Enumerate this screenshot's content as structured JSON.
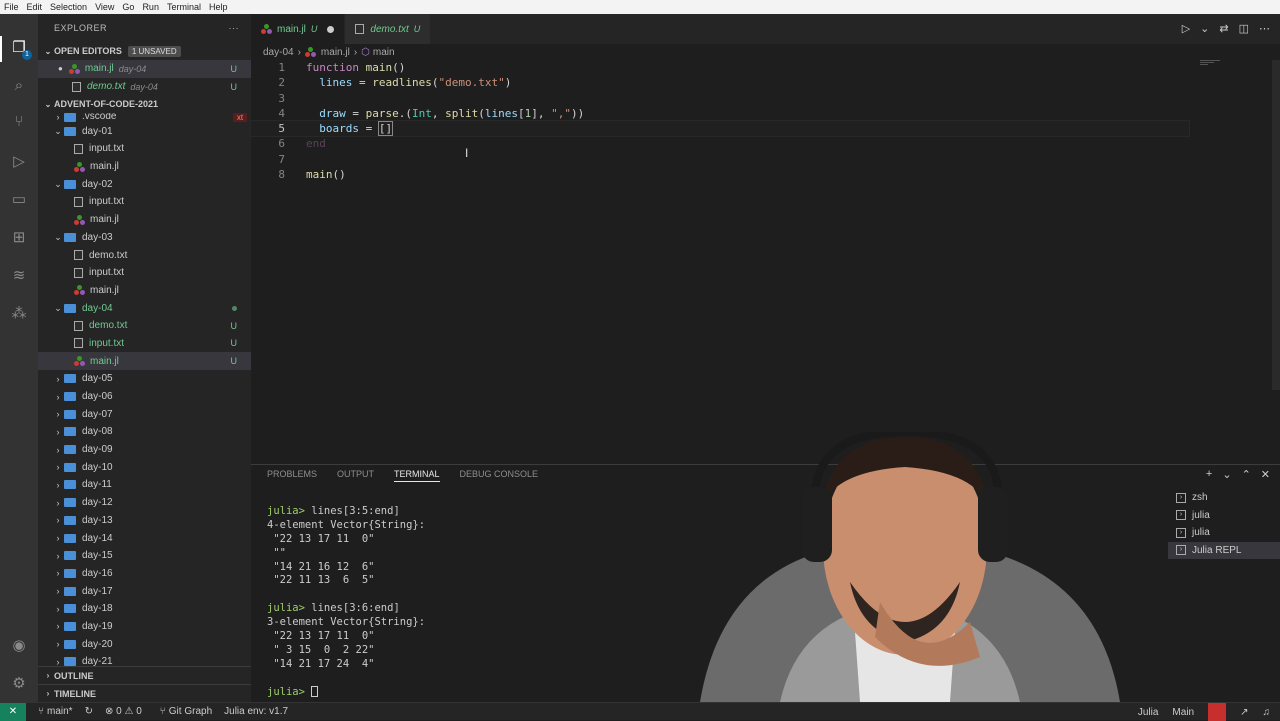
{
  "menu": [
    "File",
    "Edit",
    "Selection",
    "View",
    "Go",
    "Run",
    "Terminal",
    "Help"
  ],
  "explorer": {
    "title": "EXPLORER",
    "more": "···",
    "open_editors": {
      "label": "OPEN EDITORS",
      "badge": "1 UNSAVED"
    },
    "open_files": [
      {
        "name": "main.jl",
        "desc": "day-04",
        "status": "U"
      },
      {
        "name": "demo.txt",
        "desc": "day-04",
        "status": "U"
      }
    ],
    "workspace": "ADVENT-OF-CODE-2021",
    "vscode": ".vscode",
    "badge_x": "xt",
    "day01": {
      "name": "day-01",
      "files": [
        "input.txt",
        "main.jl"
      ]
    },
    "day02": {
      "name": "day-02",
      "files": [
        "input.txt",
        "main.jl"
      ]
    },
    "day03": {
      "name": "day-03",
      "files": [
        "demo.txt",
        "input.txt",
        "main.jl"
      ]
    },
    "day04": {
      "name": "day-04",
      "files": [
        {
          "name": "demo.txt",
          "status": "U"
        },
        {
          "name": "input.txt",
          "status": "U"
        },
        {
          "name": "main.jl",
          "status": "U"
        }
      ]
    },
    "collapsed": [
      "day-05",
      "day-06",
      "day-07",
      "day-08",
      "day-09",
      "day-10",
      "day-11",
      "day-12",
      "day-13",
      "day-14",
      "day-15",
      "day-16",
      "day-17",
      "day-18",
      "day-19",
      "day-20",
      "day-21"
    ],
    "outline": "OUTLINE",
    "timeline": "TIMELINE"
  },
  "tabs": [
    {
      "name": "main.jl",
      "tag": "U"
    },
    {
      "name": "demo.txt",
      "tag": "U"
    }
  ],
  "breadcrumb": {
    "folder": "day-04",
    "file": "main.jl",
    "symbol": "main"
  },
  "code": {
    "l1": [
      "function",
      " ",
      "main",
      "()"
    ],
    "l2": [
      "  lines",
      " = ",
      "readlines",
      "(",
      "\"demo.txt\"",
      ")"
    ],
    "l4": [
      "  draw",
      " = ",
      "parse",
      ".(",
      "Int",
      ", ",
      "split",
      "(",
      "lines",
      "[",
      "1",
      "], ",
      "\",\"",
      "))"
    ],
    "l5": [
      "  boards",
      " = ",
      "[]"
    ],
    "l6": "end",
    "l8": [
      "main",
      "()"
    ]
  },
  "panel": {
    "tabs": [
      "PROBLEMS",
      "OUTPUT",
      "TERMINAL",
      "DEBUG CONSOLE"
    ],
    "terminal_lines": [
      "julia> lines[3:5:end]",
      "4-element Vector{String}:",
      " \"22 13 17 11  0\"",
      " \"\"",
      " \"14 21 16 12  6\"",
      " \"22 11 13  6  5\"",
      "",
      "julia> lines[3:6:end]",
      "3-element Vector{String}:",
      " \"22 13 17 11  0\"",
      " \" 3 15  0  2 22\"",
      " \"14 21 17 24  4\"",
      ""
    ],
    "prompt": "julia> ",
    "terminals": [
      "zsh",
      "julia",
      "julia",
      "Julia REPL"
    ]
  },
  "status": {
    "remote": "✕",
    "branch": "main*",
    "problems": "⊗ 0 ⚠ 0",
    "gitgraph": "Git Graph",
    "julia_env": "Julia env: v1.7",
    "lang": "Julia",
    "main": "Main"
  }
}
